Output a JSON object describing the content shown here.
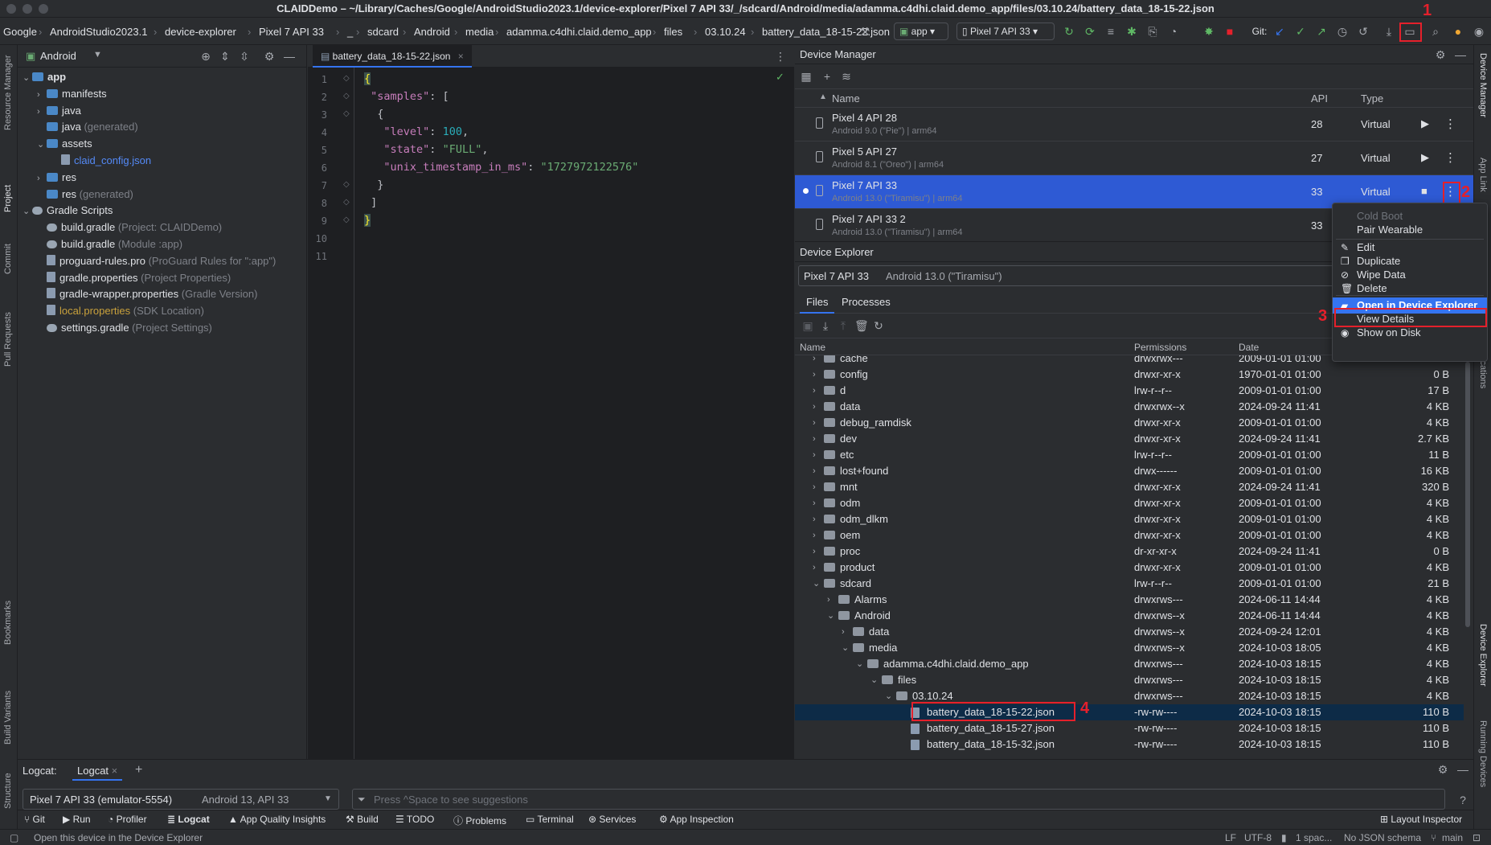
{
  "window": {
    "title": "CLAIDDemo – ~/Library/Caches/Google/AndroidStudio2023.1/device-explorer/Pixel 7 API 33/_/sdcard/Android/media/adamma.c4dhi.claid.demo_app/files/03.10.24/battery_data_18-15-22.json"
  },
  "breadcrumbs": [
    "Google",
    "AndroidStudio2023.1",
    "device-explorer",
    "Pixel 7 API 33",
    "_",
    "sdcard",
    "Android",
    "media",
    "adamma.c4dhi.claid.demo_app",
    "files",
    "03.10.24",
    "battery_data_18-15-22.json"
  ],
  "toolbar": {
    "run_config": "app",
    "device": "Pixel 7 API 33",
    "git_label": "Git:"
  },
  "left_strip": [
    "Resource Manager",
    "Project",
    "Commit",
    "Pull Requests",
    "Bookmarks",
    "Build Variants",
    "Structure"
  ],
  "right_strip": [
    "Device Manager",
    "App Link",
    "ications",
    "Device Explorer",
    "Running Devices"
  ],
  "project": {
    "view_label": "Android",
    "tree": [
      {
        "label": "app",
        "note": "",
        "type": "folder",
        "depth": 0,
        "open": true,
        "bold": true
      },
      {
        "label": "manifests",
        "note": "",
        "type": "folder",
        "depth": 1,
        "open": false
      },
      {
        "label": "java",
        "note": "",
        "type": "folder",
        "depth": 1,
        "open": false
      },
      {
        "label": "java",
        "note": " (generated)",
        "type": "folder",
        "depth": 1,
        "open": null
      },
      {
        "label": "assets",
        "note": "",
        "type": "folder",
        "depth": 1,
        "open": true
      },
      {
        "label": "claid_config.json",
        "note": "",
        "type": "file",
        "depth": 2,
        "open": null,
        "link": true
      },
      {
        "label": "res",
        "note": "",
        "type": "folder",
        "depth": 1,
        "open": false
      },
      {
        "label": "res",
        "note": " (generated)",
        "type": "folder",
        "depth": 1,
        "open": null
      },
      {
        "label": "Gradle Scripts",
        "note": "",
        "type": "gradle",
        "depth": 0,
        "open": true
      },
      {
        "label": "build.gradle",
        "note": " (Project: CLAIDDemo)",
        "type": "gradle",
        "depth": 1,
        "open": null
      },
      {
        "label": "build.gradle",
        "note": " (Module :app)",
        "type": "gradle",
        "depth": 1,
        "open": null
      },
      {
        "label": "proguard-rules.pro",
        "note": " (ProGuard Rules for \":app\")",
        "type": "file",
        "depth": 1,
        "open": null
      },
      {
        "label": "gradle.properties",
        "note": " (Project Properties)",
        "type": "file",
        "depth": 1,
        "open": null
      },
      {
        "label": "gradle-wrapper.properties",
        "note": " (Gradle Version)",
        "type": "file",
        "depth": 1,
        "open": null
      },
      {
        "label": "local.properties",
        "note": " (SDK Location)",
        "type": "file",
        "depth": 1,
        "open": null,
        "yellow": true
      },
      {
        "label": "settings.gradle",
        "note": " (Project Settings)",
        "type": "gradle",
        "depth": 1,
        "open": null
      }
    ]
  },
  "editor": {
    "tab_label": "battery_data_18-15-22.json",
    "line_numbers": [
      "1",
      "2",
      "3",
      "4",
      "5",
      "6",
      "7",
      "8",
      "9",
      "10",
      "11"
    ],
    "tokens": {
      "open_brace": "{",
      "samples_key": "\"samples\"",
      "colon_bracket": ": [",
      "inner_open": "{",
      "level_key": "\"level\"",
      "level_val": "100",
      "state_key": "\"state\"",
      "state_val": "\"FULL\"",
      "ts_key": "\"unix_timestamp_in_ms\"",
      "ts_val": "\"1727972122576\"",
      "inner_close": "}",
      "close_bracket": "]",
      "close_brace": "}",
      "colon": ": ",
      "comma": ","
    }
  },
  "device_manager": {
    "title": "Device Manager",
    "columns": {
      "name": "Name",
      "api": "API",
      "type": "Type"
    },
    "devices": [
      {
        "name": "Pixel 4 API 28",
        "sub": "Android 9.0 (\"Pie\") | arm64",
        "api": "28",
        "type": "Virtual",
        "selected": false
      },
      {
        "name": "Pixel 5 API 27",
        "sub": "Android 8.1 (\"Oreo\") | arm64",
        "api": "27",
        "type": "Virtual",
        "selected": false
      },
      {
        "name": "Pixel 7 API 33",
        "sub": "Android 13.0 (\"Tiramisu\") | arm64",
        "api": "33",
        "type": "Virtual",
        "selected": true
      },
      {
        "name": "Pixel 7 API 33 2",
        "sub": "Android 13.0 (\"Tiramisu\") | arm64",
        "api": "33",
        "type": "",
        "selected": false
      }
    ]
  },
  "context_menu": [
    {
      "label": "Cold Boot",
      "disabled": true,
      "icon": ""
    },
    {
      "label": "Pair Wearable",
      "disabled": false,
      "icon": ""
    },
    {
      "label": "Edit",
      "disabled": false,
      "icon": "pencil"
    },
    {
      "label": "Duplicate",
      "disabled": false,
      "icon": "copy"
    },
    {
      "label": "Wipe Data",
      "disabled": false,
      "icon": "ban"
    },
    {
      "label": "Delete",
      "disabled": false,
      "icon": "trash"
    },
    {
      "label": "Open in Device Explorer",
      "disabled": false,
      "icon": "folder",
      "highlight": true
    },
    {
      "label": "View Details",
      "disabled": false,
      "icon": ""
    },
    {
      "label": "Show on Disk",
      "disabled": false,
      "icon": "eye"
    }
  ],
  "device_explorer": {
    "title": "Device Explorer",
    "device_name": "Pixel 7 API 33",
    "device_sub": "Android 13.0 (\"Tiramisu\")",
    "tabs": [
      "Files",
      "Processes"
    ],
    "columns": {
      "name": "Name",
      "permissions": "Permissions",
      "date": "Date"
    },
    "rows": [
      {
        "name": "cache",
        "perm": "drwxrwx---",
        "date": "2009-01-01 01:00",
        "size": "",
        "depth": 0,
        "kind": "folder",
        "open": false
      },
      {
        "name": "config",
        "perm": "drwxr-xr-x",
        "date": "1970-01-01 01:00",
        "size": "0 B",
        "depth": 0,
        "kind": "folder",
        "open": false
      },
      {
        "name": "d",
        "perm": "lrw-r--r--",
        "date": "2009-01-01 01:00",
        "size": "17 B",
        "depth": 0,
        "kind": "link",
        "open": false
      },
      {
        "name": "data",
        "perm": "drwxrwx--x",
        "date": "2024-09-24 11:41",
        "size": "4 KB",
        "depth": 0,
        "kind": "folder",
        "open": false
      },
      {
        "name": "debug_ramdisk",
        "perm": "drwxr-xr-x",
        "date": "2009-01-01 01:00",
        "size": "4 KB",
        "depth": 0,
        "kind": "folder",
        "open": false
      },
      {
        "name": "dev",
        "perm": "drwxr-xr-x",
        "date": "2024-09-24 11:41",
        "size": "2.7 KB",
        "depth": 0,
        "kind": "folder",
        "open": false
      },
      {
        "name": "etc",
        "perm": "lrw-r--r--",
        "date": "2009-01-01 01:00",
        "size": "11 B",
        "depth": 0,
        "kind": "link",
        "open": false
      },
      {
        "name": "lost+found",
        "perm": "drwx------",
        "date": "2009-01-01 01:00",
        "size": "16 KB",
        "depth": 0,
        "kind": "folder",
        "open": false
      },
      {
        "name": "mnt",
        "perm": "drwxr-xr-x",
        "date": "2024-09-24 11:41",
        "size": "320 B",
        "depth": 0,
        "kind": "folder",
        "open": false
      },
      {
        "name": "odm",
        "perm": "drwxr-xr-x",
        "date": "2009-01-01 01:00",
        "size": "4 KB",
        "depth": 0,
        "kind": "folder",
        "open": false
      },
      {
        "name": "odm_dlkm",
        "perm": "drwxr-xr-x",
        "date": "2009-01-01 01:00",
        "size": "4 KB",
        "depth": 0,
        "kind": "folder",
        "open": false
      },
      {
        "name": "oem",
        "perm": "drwxr-xr-x",
        "date": "2009-01-01 01:00",
        "size": "4 KB",
        "depth": 0,
        "kind": "folder",
        "open": false
      },
      {
        "name": "proc",
        "perm": "dr-xr-xr-x",
        "date": "2024-09-24 11:41",
        "size": "0 B",
        "depth": 0,
        "kind": "folder",
        "open": false
      },
      {
        "name": "product",
        "perm": "drwxr-xr-x",
        "date": "2009-01-01 01:00",
        "size": "4 KB",
        "depth": 0,
        "kind": "folder",
        "open": false
      },
      {
        "name": "sdcard",
        "perm": "lrw-r--r--",
        "date": "2009-01-01 01:00",
        "size": "21 B",
        "depth": 0,
        "kind": "link",
        "open": true
      },
      {
        "name": "Alarms",
        "perm": "drwxrws---",
        "date": "2024-06-11 14:44",
        "size": "4 KB",
        "depth": 1,
        "kind": "folder",
        "open": false
      },
      {
        "name": "Android",
        "perm": "drwxrws--x",
        "date": "2024-06-11 14:44",
        "size": "4 KB",
        "depth": 1,
        "kind": "folder",
        "open": true
      },
      {
        "name": "data",
        "perm": "drwxrws--x",
        "date": "2024-09-24 12:01",
        "size": "4 KB",
        "depth": 2,
        "kind": "folder",
        "open": false
      },
      {
        "name": "media",
        "perm": "drwxrws--x",
        "date": "2024-10-03 18:05",
        "size": "4 KB",
        "depth": 2,
        "kind": "folder",
        "open": true
      },
      {
        "name": "adamma.c4dhi.claid.demo_app",
        "perm": "drwxrws---",
        "date": "2024-10-03 18:15",
        "size": "4 KB",
        "depth": 3,
        "kind": "folder",
        "open": true
      },
      {
        "name": "files",
        "perm": "drwxrws---",
        "date": "2024-10-03 18:15",
        "size": "4 KB",
        "depth": 4,
        "kind": "folder",
        "open": true
      },
      {
        "name": "03.10.24",
        "perm": "drwxrws---",
        "date": "2024-10-03 18:15",
        "size": "4 KB",
        "depth": 5,
        "kind": "folder",
        "open": true
      },
      {
        "name": "battery_data_18-15-22.json",
        "perm": "-rw-rw----",
        "date": "2024-10-03 18:15",
        "size": "110 B",
        "depth": 6,
        "kind": "file",
        "open": null,
        "selected": true
      },
      {
        "name": "battery_data_18-15-27.json",
        "perm": "-rw-rw----",
        "date": "2024-10-03 18:15",
        "size": "110 B",
        "depth": 6,
        "kind": "file",
        "open": null
      },
      {
        "name": "battery_data_18-15-32.json",
        "perm": "-rw-rw----",
        "date": "2024-10-03 18:15",
        "size": "110 B",
        "depth": 6,
        "kind": "file",
        "open": null
      }
    ]
  },
  "logcat": {
    "label": "Logcat:",
    "tab": "Logcat",
    "device": "Pixel 7 API 33 (emulator-5554)",
    "device_sub": "Android 13, API 33",
    "filter_placeholder": "Press ^Space to see suggestions"
  },
  "toolwindows": [
    "Git",
    "Run",
    "Profiler",
    "Logcat",
    "App Quality Insights",
    "Build",
    "TODO",
    "Problems",
    "Terminal",
    "Services",
    "App Inspection"
  ],
  "layout_inspector": "Layout Inspector",
  "status": {
    "message": "Open this device in the Device Explorer",
    "line_sep": "LF",
    "encoding": "UTF-8",
    "indent": "1 spac...",
    "schema": "No JSON schema",
    "branch": "main"
  },
  "annotations": [
    "1",
    "2",
    "3",
    "4"
  ],
  "colors": {
    "accent": "#3574f0",
    "annotation": "#e5202b",
    "selection": "#2e5ad4"
  }
}
